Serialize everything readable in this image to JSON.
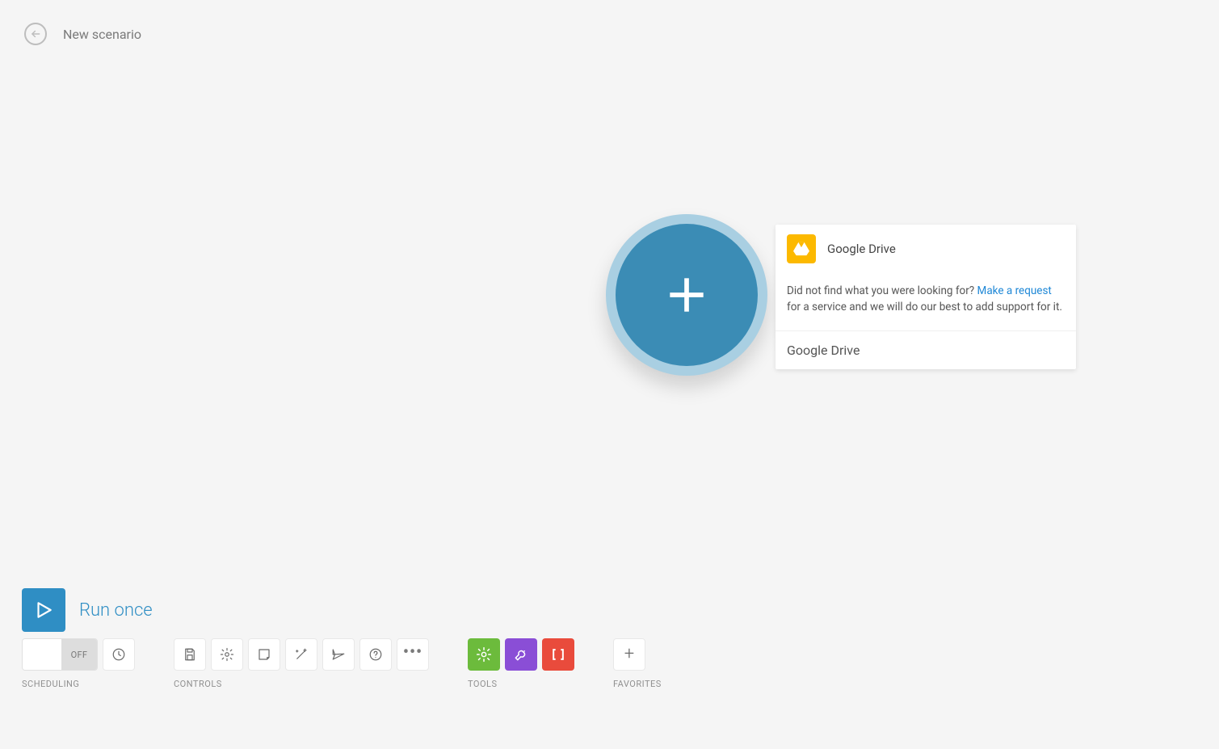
{
  "header": {
    "title": "New scenario"
  },
  "run": {
    "label": "Run once"
  },
  "toggle": {
    "state": "OFF"
  },
  "groups": {
    "scheduling": "SCHEDULING",
    "controls": "CONTROLS",
    "tools": "TOOLS",
    "favorites": "FAVORITES"
  },
  "suggest": {
    "service_name": "Google Drive",
    "request_prefix": "Did not find what you were looking for? ",
    "request_link": "Make a request",
    "request_suffix": " for a service and we will do our best to add support for it.",
    "search_value": "Google Drive"
  }
}
